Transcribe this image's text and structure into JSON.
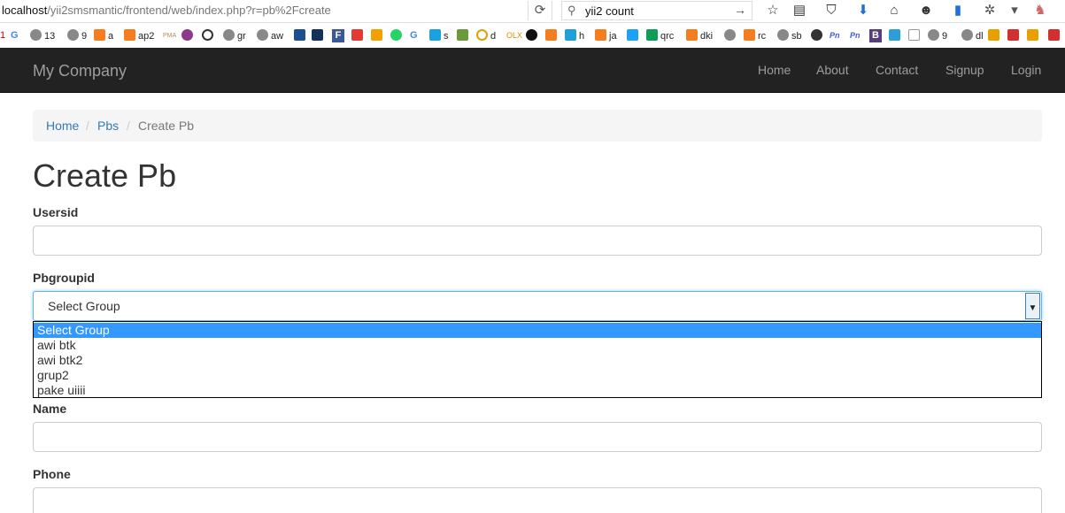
{
  "browser": {
    "url_host": "localhost",
    "url_path": "/yii2smsmantic/frontend/web/index.php?r=pb%2Fcreate",
    "search_query": "yii2 count",
    "bookmarks": [
      "1",
      "G",
      "13",
      "9",
      "a",
      "ap2",
      "PMA",
      "gr",
      "aw",
      "",
      "F",
      "",
      "",
      "",
      "G",
      "",
      "s",
      "",
      "d",
      "",
      "",
      "",
      "h",
      "ja",
      "",
      "qrc",
      "dki",
      "rc",
      "sb",
      "",
      "Pn",
      "Pn",
      "B",
      "",
      "",
      "9",
      "dl",
      "",
      "",
      "",
      ""
    ]
  },
  "navbar": {
    "brand": "My Company",
    "links": [
      "Home",
      "About",
      "Contact",
      "Signup",
      "Login"
    ]
  },
  "breadcrumb": {
    "items": [
      "Home",
      "Pbs",
      "Create Pb"
    ],
    "separator": "/"
  },
  "page": {
    "title": "Create Pb"
  },
  "form": {
    "usersid_label": "Usersid",
    "usersid_value": "",
    "pbgroupid_label": "Pbgroupid",
    "pbgroupid_selected": "Select Group",
    "pbgroupid_options": [
      "Select Group",
      "awi btk",
      "awi btk2",
      "grup2",
      "pake uiiii"
    ],
    "name_label": "Name",
    "name_value": "",
    "phone_label": "Phone",
    "phone_value": ""
  },
  "colors": {
    "navbar_bg": "#222222",
    "link": "#337ab7",
    "focus_border": "#66afe9",
    "option_highlight": "#3399ff"
  }
}
